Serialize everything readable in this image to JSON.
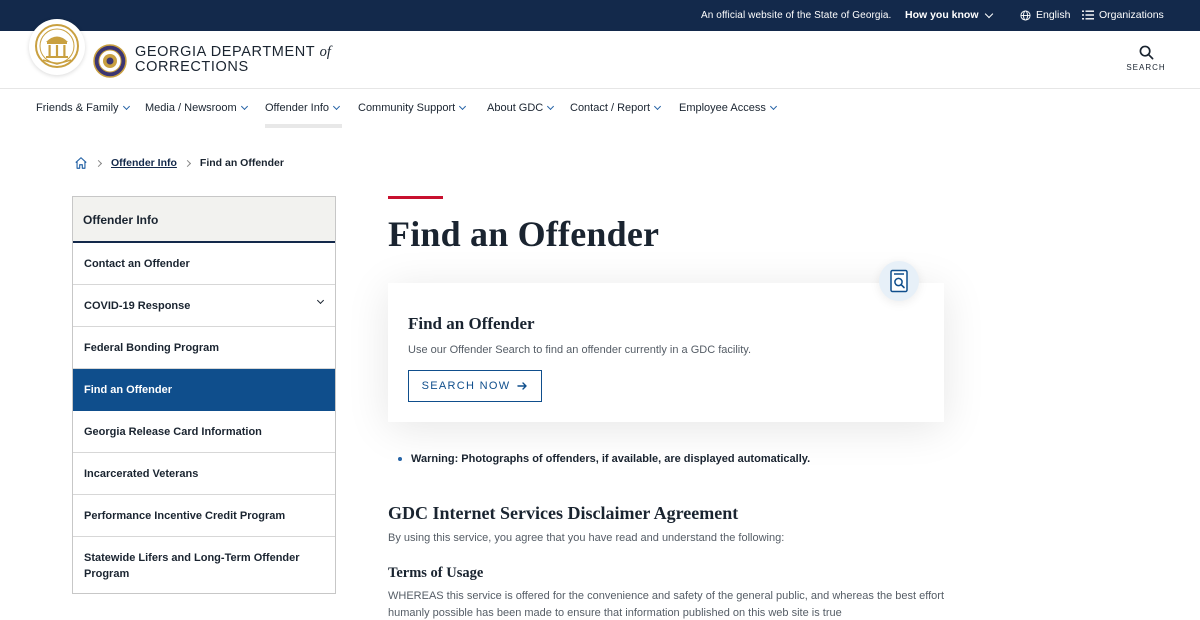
{
  "banner": {
    "official_text": "An official website of the State of Georgia.",
    "how_you_know": "How you know",
    "language": "English",
    "organizations": "Organizations"
  },
  "header": {
    "agency_line1": "GEORGIA DEPARTMENT",
    "agency_of": "of",
    "agency_line2": "CORRECTIONS",
    "search_label": "SEARCH"
  },
  "nav": {
    "items": [
      {
        "label": "Friends & Family"
      },
      {
        "label": "Media / Newsroom"
      },
      {
        "label": "Offender Info"
      },
      {
        "label": "Community Support"
      },
      {
        "label": "About GDC"
      },
      {
        "label": "Contact / Report"
      },
      {
        "label": "Employee Access"
      }
    ]
  },
  "breadcrumb": {
    "parent": "Offender Info",
    "current": "Find an Offender"
  },
  "sidebar": {
    "heading": "Offender Info",
    "items": [
      {
        "label": "Contact an Offender"
      },
      {
        "label": "COVID-19 Response"
      },
      {
        "label": "Federal Bonding Program"
      },
      {
        "label": "Find an Offender"
      },
      {
        "label": "Georgia Release Card Information"
      },
      {
        "label": "Incarcerated Veterans"
      },
      {
        "label": "Performance Incentive Credit Program"
      },
      {
        "label": "Statewide Lifers and Long-Term Offender Program"
      }
    ]
  },
  "main": {
    "title": "Find an Offender",
    "card": {
      "title": "Find an Offender",
      "description": "Use our Offender Search to find an offender currently in a GDC facility.",
      "button": "SEARCH NOW"
    },
    "warning": "Warning: Photographs of offenders, if available, are displayed automatically.",
    "disclaimer_heading": "GDC Internet Services Disclaimer Agreement",
    "disclaimer_intro": "By using this service, you agree that you have read and understand the following:",
    "terms_heading": "Terms of Usage",
    "terms_text": "WHEREAS this service is offered for the convenience and safety of the general public, and whereas the best effort humanly possible has been made to ensure that information published on this web site is true"
  },
  "colors": {
    "navy": "#13294b",
    "active_blue": "#0f4e8c",
    "accent_red": "#c8102e"
  },
  "icons": {
    "globe": "globe-icon",
    "list": "list-icon",
    "search": "search-icon",
    "home": "home-icon",
    "arrow": "arrow-right-icon",
    "document_search": "document-search-icon"
  }
}
